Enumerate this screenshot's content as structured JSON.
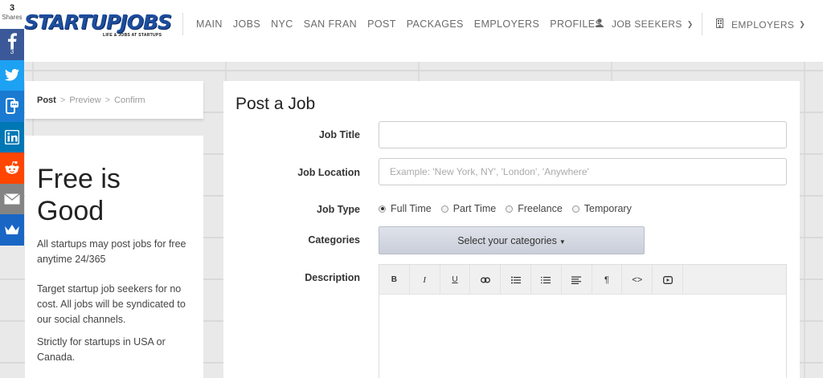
{
  "share": {
    "count": "3",
    "label": "Shares",
    "facebook_count": "3",
    "colors": {
      "facebook": "#3b5998",
      "twitter": "#1da1f2",
      "sms": "#1a7ad1",
      "linkedin": "#0077b5",
      "reddit": "#ff4500",
      "email": "#848484",
      "sumo": "#1a66c5"
    }
  },
  "header": {
    "logo_text": "STARTUPJOBS",
    "logo_tagline": "LIFE & JOBS AT STARTUPS",
    "nav": [
      "MAIN",
      "JOBS",
      "NYC",
      "SAN FRAN",
      "POST",
      "PACKAGES",
      "EMPLOYERS",
      "PROFILES"
    ],
    "job_seekers_label": "JOB SEEKERS",
    "employers_label": "EMPLOYERS"
  },
  "breadcrumb": {
    "current": "Post",
    "step2": "Preview",
    "step3": "Confirm",
    "separator": ">"
  },
  "promo": {
    "headline_line1": "Free is",
    "headline_line2": "Good",
    "p1": "All startups may post jobs for free anytime 24/365",
    "p2": "Target startup job seekers for no cost. All jobs will be syndicated to our social channels.",
    "p3": "Strictly for startups in USA or Canada."
  },
  "form": {
    "title": "Post a Job",
    "job_title_label": "Job Title",
    "job_title_value": "",
    "job_location_label": "Job Location",
    "job_location_placeholder": "Example: 'New York, NY', 'London', 'Anywhere'",
    "job_type_label": "Job Type",
    "job_types": [
      {
        "label": "Full Time",
        "selected": true
      },
      {
        "label": "Part Time",
        "selected": false
      },
      {
        "label": "Freelance",
        "selected": false
      },
      {
        "label": "Temporary",
        "selected": false
      }
    ],
    "categories_label": "Categories",
    "categories_button": "Select your categories",
    "description_label": "Description",
    "toolbar": {
      "bold": "B",
      "italic": "I",
      "underline": "U",
      "link_icon": "link-icon",
      "bullet_list_icon": "bullet-list-icon",
      "numbered_list_icon": "numbered-list-icon",
      "align_icon": "align-icon",
      "paragraph": "¶",
      "code": "<>",
      "video_icon": "video-icon"
    }
  }
}
